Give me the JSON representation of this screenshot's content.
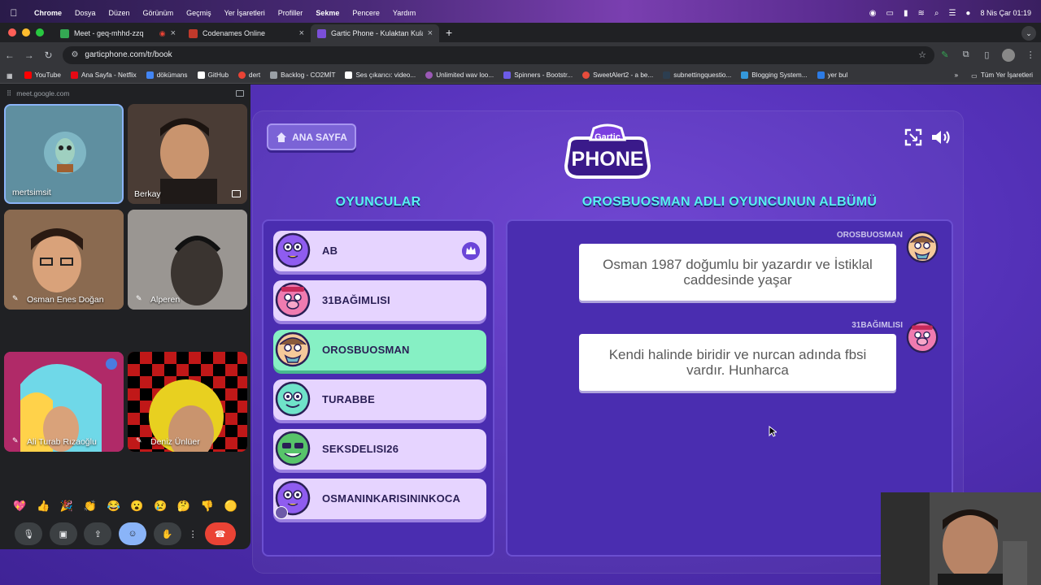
{
  "menubar": {
    "app": "Chrome",
    "items": [
      "Dosya",
      "Düzen",
      "Görünüm",
      "Geçmiş",
      "Yer İşaretleri",
      "Profiller",
      "Sekme",
      "Pencere",
      "Yardım"
    ],
    "clock": "8 Nis Çar  01:19"
  },
  "tabs": [
    {
      "title": "Meet - geq-mhhd-zzq",
      "color": "#34a853"
    },
    {
      "title": "Codenames Online",
      "color": "#c0392b"
    },
    {
      "title": "Gartic Phone - Kulaktan Kulağa",
      "color": "#7b4fd8"
    }
  ],
  "toolbar": {
    "url": "garticphone.com/tr/book"
  },
  "bookmarks": [
    {
      "label": "YouTube",
      "color": "#ff0000"
    },
    {
      "label": "Ana Sayfa - Netflix",
      "color": "#e50914"
    },
    {
      "label": "dökümans",
      "color": "#4285f4"
    },
    {
      "label": "GitHub",
      "color": "#ffffff"
    },
    {
      "label": "dert",
      "color": "#ea4335"
    },
    {
      "label": "Backlog - CO2MİT",
      "color": "#9aa0a6"
    },
    {
      "label": "Ses çıkarıcı: video...",
      "color": "#ffffff"
    },
    {
      "label": "Unlimited wav loo...",
      "color": "#9b59b6"
    },
    {
      "label": "Spinners - Bootstr...",
      "color": "#6c5ce7"
    },
    {
      "label": "SweetAlert2 - a be...",
      "color": "#e74c3c"
    },
    {
      "label": "subnettingquestio...",
      "color": "#2c3e50"
    },
    {
      "label": "Blogging System...",
      "color": "#3498db"
    },
    {
      "label": "yer bul",
      "color": "#2c7be5"
    }
  ],
  "bookmarks_all": "Tüm Yer İşaretleri",
  "meet": {
    "header": "meet.google.com",
    "participants": [
      {
        "name": "mertsimsit",
        "bg": "#5f8fa0"
      },
      {
        "name": "Berkay",
        "bg": "#3b2f2a"
      },
      {
        "name": "Osman Enes Doğan",
        "bg": "#7a5a40"
      },
      {
        "name": "Alperen",
        "bg": "#6e6a66"
      },
      {
        "name": "Ali Turab Rızaoğlu",
        "bg": "#c0306a"
      },
      {
        "name": "Deniz Ünlüer",
        "bg": "#b01818"
      }
    ],
    "reactions": [
      "💖",
      "👍",
      "🎉",
      "👏",
      "😂",
      "😮",
      "😢",
      "🤔",
      "👎",
      "🟡"
    ]
  },
  "game": {
    "home_label": "ANA SAYFA",
    "logo_top": "Gartic",
    "logo_bottom": "PHONE",
    "players_title": "OYUNCULAR",
    "album_title": "OROSBUOSMAN ADLI OYUNCUNUN ALBÜMÜ",
    "players": [
      {
        "name": "AB",
        "active": false,
        "color": "#8f5cf0"
      },
      {
        "name": "31BAĞIMLISI",
        "active": false,
        "color": "#f07bb0"
      },
      {
        "name": "OROSBUOSMAN",
        "active": true,
        "color": "#f5c99a"
      },
      {
        "name": "TURABBE",
        "active": false,
        "color": "#6fe3c9"
      },
      {
        "name": "SEKSDELISI26",
        "active": false,
        "color": "#57c46a"
      },
      {
        "name": "OSMANINKARISININKOCA",
        "active": false,
        "color": "#8f5cf0"
      }
    ],
    "album": [
      {
        "author": "OROSBUOSMAN",
        "text": "Osman 1987 doğumlu bir yazardır ve İstiklal caddesinde yaşar"
      },
      {
        "author": "31BAĞIMLISI",
        "text": "Kendi halinde biridir ve nurcan adında fbsi vardır. Hunharca"
      }
    ]
  }
}
